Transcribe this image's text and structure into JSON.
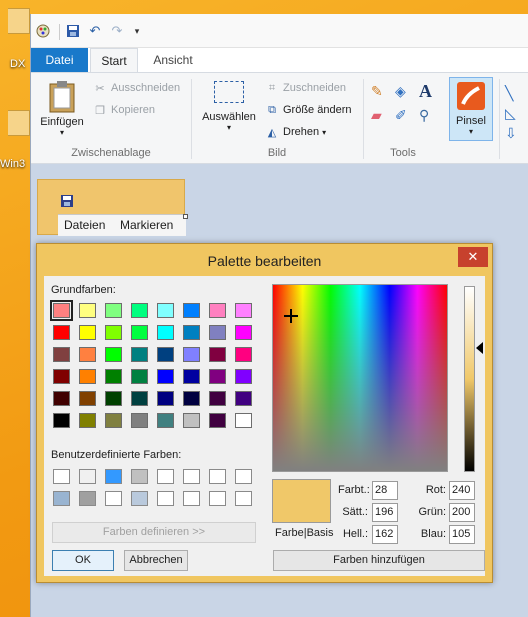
{
  "desktop": {
    "icons": [
      {
        "label": "DX"
      },
      {
        "label": "Win3"
      }
    ]
  },
  "paint": {
    "quick_access": [
      "paint-icon",
      "save-icon",
      "undo-icon",
      "redo-icon",
      "customize-icon"
    ],
    "tabs": [
      "Datei",
      "Start",
      "Ansicht"
    ],
    "ribbon": {
      "zwischenablage": {
        "label": "Zwischenablage",
        "einfuegen": "Einfügen",
        "ausschneiden": "Ausschneiden",
        "kopieren": "Kopieren"
      },
      "bild": {
        "label": "Bild",
        "auswaehlen": "Auswählen",
        "zuschneiden": "Zuschneiden",
        "groesse": "Größe ändern",
        "drehen": "Drehen"
      },
      "tools": {
        "label": "Tools"
      },
      "pinsel": "Pinsel"
    },
    "canvas_window": {
      "menu": [
        "Dateien",
        "Markieren"
      ]
    }
  },
  "dialog": {
    "title": "Palette bearbeiten",
    "close": "✕",
    "basic_colors_label": "Grundfarben:",
    "basic_colors": [
      [
        "#ff8080",
        "#ffff80",
        "#80ff80",
        "#00ff80",
        "#80ffff",
        "#0080ff",
        "#ff80c0",
        "#ff80ff"
      ],
      [
        "#ff0000",
        "#ffff00",
        "#80ff00",
        "#00ff40",
        "#00ffff",
        "#0080c0",
        "#8080c0",
        "#ff00ff"
      ],
      [
        "#804040",
        "#ff8040",
        "#00ff00",
        "#008080",
        "#004080",
        "#8080ff",
        "#800040",
        "#ff0080"
      ],
      [
        "#800000",
        "#ff8000",
        "#008000",
        "#008040",
        "#0000ff",
        "#0000a0",
        "#800080",
        "#8000ff"
      ],
      [
        "#400000",
        "#804000",
        "#004000",
        "#004040",
        "#000080",
        "#000040",
        "#400040",
        "#400080"
      ],
      [
        "#000000",
        "#808000",
        "#808040",
        "#808080",
        "#408080",
        "#c0c0c0",
        "#400040",
        "#ffffff"
      ]
    ],
    "custom_colors_label": "Benutzerdefinierte Farben:",
    "custom_colors": [
      [
        "#ffffff",
        "#f0f0f0",
        "#3399ff",
        "#c0c0c0",
        "#ffffff",
        "#ffffff",
        "#ffffff",
        "#ffffff"
      ],
      [
        "#99b4d1",
        "#a0a0a0",
        "#ffffff",
        "#b9c9dc",
        "#ffffff",
        "#ffffff",
        "#ffffff",
        "#ffffff"
      ]
    ],
    "define_colors": "Farben definieren >>",
    "ok": "OK",
    "cancel": "Abbrechen",
    "preview_label": "Farbe|Basis",
    "preview_color": "#f0c869",
    "hue_label": "Farbt.:",
    "hue": "28",
    "sat_label": "Sätt.:",
    "sat": "196",
    "lum_label": "Hell.:",
    "lum": "162",
    "red_label": "Rot:",
    "red": "240",
    "green_label": "Grün:",
    "green": "200",
    "blue_label": "Blau:",
    "blue": "105",
    "add_colors": "Farben hinzufügen"
  }
}
